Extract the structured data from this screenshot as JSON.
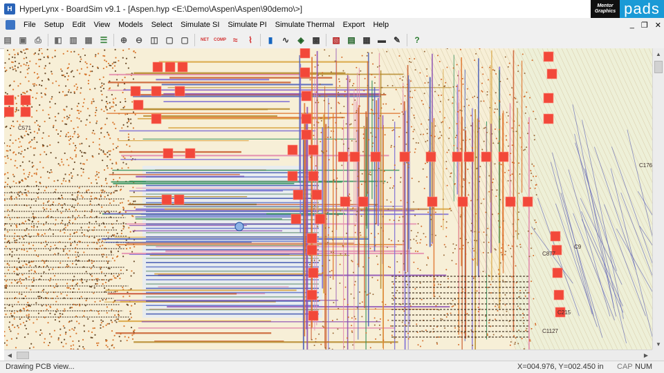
{
  "window": {
    "title": "HyperLynx - BoardSim v9.1 - [Aspen.hyp <E:\\Demo\\Aspen\\Aspen\\90demo\\>]",
    "brand_mentor": "Mentor Graphics",
    "brand_pads": "pads"
  },
  "menu": {
    "items": [
      "File",
      "Setup",
      "Edit",
      "View",
      "Models",
      "Select",
      "Simulate SI",
      "Simulate PI",
      "Simulate Thermal",
      "Export",
      "Help"
    ],
    "minimize": "_",
    "restore": "❐",
    "close": "✕"
  },
  "toolbar": {
    "buttons": [
      {
        "name": "open-board-icon",
        "glyph": "▤",
        "color": "#6a6a6a"
      },
      {
        "name": "save-icon",
        "glyph": "▣",
        "color": "#6a6a6a"
      },
      {
        "name": "print-icon",
        "glyph": "⎙",
        "color": "#6a6a6a"
      },
      {
        "name": "board-wizard-icon",
        "glyph": "◧",
        "color": "#6a6a6a"
      },
      {
        "name": "component-icon",
        "glyph": "▥",
        "color": "#6a6a6a"
      },
      {
        "name": "layer-icon",
        "glyph": "▦",
        "color": "#6a6a6a"
      },
      {
        "name": "stackup-icon",
        "glyph": "☰",
        "color": "#2e7d32"
      },
      {
        "name": "zoom-in-icon",
        "glyph": "⊕",
        "color": "#555"
      },
      {
        "name": "zoom-out-icon",
        "glyph": "⊖",
        "color": "#555"
      },
      {
        "name": "fit-view-icon",
        "glyph": "◫",
        "color": "#555"
      },
      {
        "name": "highlight-net-icon",
        "glyph": "▢",
        "color": "#555"
      },
      {
        "name": "find-icon",
        "glyph": "▢",
        "color": "#555"
      },
      {
        "name": "net-icon",
        "glyph": "NET",
        "color": "#d32f2f"
      },
      {
        "name": "comp-icon",
        "glyph": "COMP",
        "color": "#d32f2f"
      },
      {
        "name": "crosstalk-icon",
        "glyph": "≈",
        "color": "#d32f2f"
      },
      {
        "name": "terminator-icon",
        "glyph": "⌇",
        "color": "#d32f2f"
      },
      {
        "name": "eye-diagram-icon",
        "glyph": "▮",
        "color": "#1565c0"
      },
      {
        "name": "waveform-icon",
        "glyph": "∿",
        "color": "#333"
      },
      {
        "name": "oscilloscope-icon",
        "glyph": "◈",
        "color": "#1b5e20"
      },
      {
        "name": "spectrum-icon",
        "glyph": "▩",
        "color": "#333"
      },
      {
        "name": "batch-icon",
        "glyph": "▧",
        "color": "#b71c1c"
      },
      {
        "name": "report-icon",
        "glyph": "▤",
        "color": "#1b5e20"
      },
      {
        "name": "grid-icon",
        "glyph": "▦",
        "color": "#333"
      },
      {
        "name": "thermal-icon",
        "glyph": "▬",
        "color": "#333"
      },
      {
        "name": "pi-icon",
        "glyph": "✎",
        "color": "#333"
      },
      {
        "name": "help-icon",
        "glyph": "?",
        "color": "#2e7d32"
      }
    ]
  },
  "canvas": {
    "refdes_labels": [
      "C571",
      "C877",
      "C1127",
      "C176",
      "C215",
      "C9"
    ]
  },
  "scroll": {
    "up": "▲",
    "down": "▼",
    "left": "◀",
    "right": "▶"
  },
  "status": {
    "message": "Drawing PCB view...",
    "coords": "X=004.976, Y=002.450 in",
    "cap": "CAP",
    "num": "NUM"
  }
}
